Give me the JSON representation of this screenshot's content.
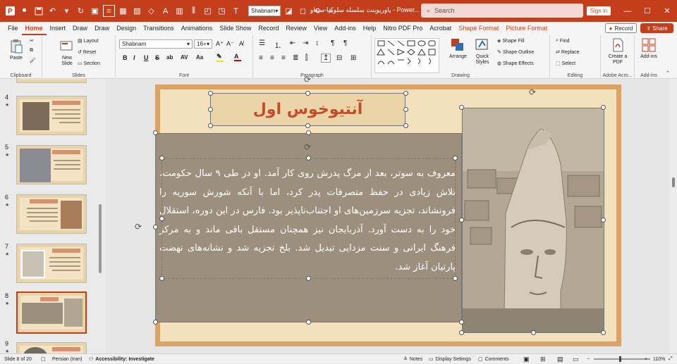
{
  "titlebar": {
    "font_quick": "Shabnam",
    "doc_title": "پاورپوینت سلسله سلوکیا-سیناو - Power...",
    "search_placeholder": "Search",
    "signin": "Sign in",
    "icons": [
      "save-icon",
      "autosave-icon",
      "undo-icon",
      "redo-icon",
      "start-from-beginning-icon",
      "view-icon",
      "table-icon",
      "picture-icon",
      "shape-icon",
      "textbox-icon",
      "chart-icon",
      "align-icon",
      "send-icon",
      "bring-icon",
      "fill-icon",
      "outline-icon",
      "rotate-icon",
      "more-icon"
    ]
  },
  "tabs": [
    "File",
    "Home",
    "Insert",
    "Draw",
    "Draw",
    "Design",
    "Transitions",
    "Animations",
    "Slide Show",
    "Record",
    "Review",
    "View",
    "Add-ins",
    "Help",
    "Nitro PDF Pro",
    "Acrobat",
    "Shape Format",
    "Picture Format"
  ],
  "active_tab": "Home",
  "record_label": "Record",
  "share_label": "Share",
  "ribbon": {
    "clipboard": {
      "paste": "Paste",
      "label": "Clipboard"
    },
    "slides": {
      "new_slide": "New Slide",
      "layout": "Layout",
      "reset": "Reset",
      "section": "Section",
      "label": "Slides"
    },
    "font": {
      "name": "Shabnam",
      "size": "16+",
      "label": "Font",
      "bold": "B",
      "italic": "I",
      "underline": "U",
      "strike": "S",
      "shadow": "ab",
      "spacing": "AV",
      "case": "Aa"
    },
    "paragraph": {
      "label": "Paragraph"
    },
    "drawing": {
      "arrange": "Arrange",
      "quick_styles": "Quick Styles",
      "shape_fill": "Shape Fill",
      "shape_outline": "Shape Outline",
      "shape_effects": "Shape Effects",
      "label": "Drawing"
    },
    "editing": {
      "find": "Find",
      "replace": "Replace",
      "select": "Select",
      "label": "Editing"
    },
    "acrobat": {
      "create_pdf": "Create a PDF",
      "label": "Adobe Acro..."
    },
    "addins": {
      "addins": "Add-ins",
      "label": "Add-ins"
    }
  },
  "slides_pane": [
    {
      "num": "4",
      "star": "★"
    },
    {
      "num": "5",
      "star": "★"
    },
    {
      "num": "6",
      "star": "★"
    },
    {
      "num": "7",
      "star": "★"
    },
    {
      "num": "8",
      "star": "★"
    },
    {
      "num": "9",
      "star": "★"
    }
  ],
  "slide": {
    "title": "آنتیوخوس اول",
    "body": "معروف به سوتر، بعد از مرگ پدرش روی کار آمد. او در طی ۹ سال حکومت، تلاش زیادی در حفظ متصرفات پدر کرد، اما با آنکه شورش سوریه را فرونشاند، تجزیه سرزمین‌های او اجتناب‌ناپذیر بود. فارس در این دوره، استقلال خود را به دست آورد. آذربایجان نیز همچنان مستقل باقی ماند و به مرکز فرهنگ ایرانی و سنت مزدایی تبدیل شد. بلخ تجزیه شد و نشانه‌های نهضت پارتیان آغاز شد."
  },
  "status": {
    "slide_of": "Slide 8 of 20",
    "language": "Persian (Iran)",
    "accessibility": "Accessibility: Investigate",
    "notes": "Notes",
    "display_settings": "Display Settings",
    "comments": "Comments",
    "zoom": "110%"
  },
  "colors": {
    "accent": "#c43e1c",
    "title_red": "#c94a2a"
  }
}
